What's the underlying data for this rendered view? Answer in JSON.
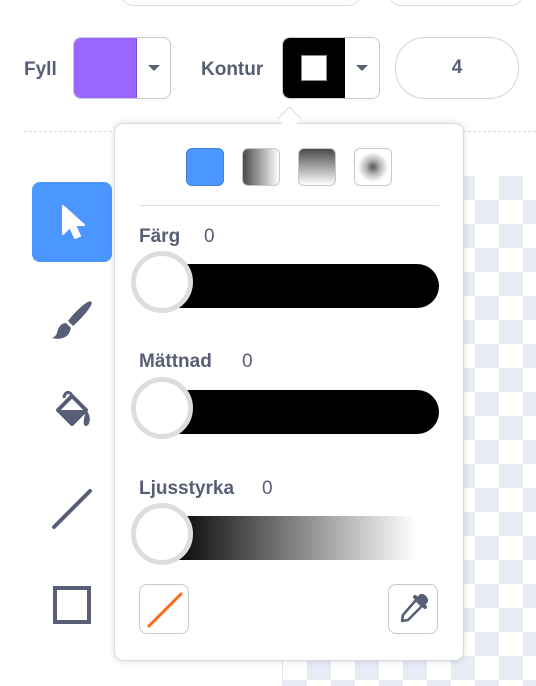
{
  "toolbar": {
    "fill_label": "Fyll",
    "fill_color": "#9966ff",
    "outline_label": "Kontur",
    "outline_color": "#000000",
    "stroke_width": "4"
  },
  "color_picker": {
    "modes": [
      "solid",
      "gradient-horizontal",
      "gradient-vertical",
      "gradient-radial"
    ],
    "selected_mode": "solid",
    "sliders": [
      {
        "label": "Färg",
        "value": "0"
      },
      {
        "label": "Mättnad",
        "value": "0"
      },
      {
        "label": "Ljusstyrka",
        "value": "0"
      }
    ],
    "accent": "#4c97ff",
    "no_color_icon": "no-color-icon",
    "eyedropper_icon": "eyedropper-icon"
  },
  "tools": [
    {
      "name": "select-tool",
      "icon": "arrow-cursor-icon",
      "active": true
    },
    {
      "name": "brush-tool",
      "icon": "brush-icon"
    },
    {
      "name": "fill-tool",
      "icon": "paint-bucket-icon"
    },
    {
      "name": "line-tool",
      "icon": "line-icon"
    },
    {
      "name": "rectangle-tool",
      "icon": "rectangle-icon"
    }
  ]
}
